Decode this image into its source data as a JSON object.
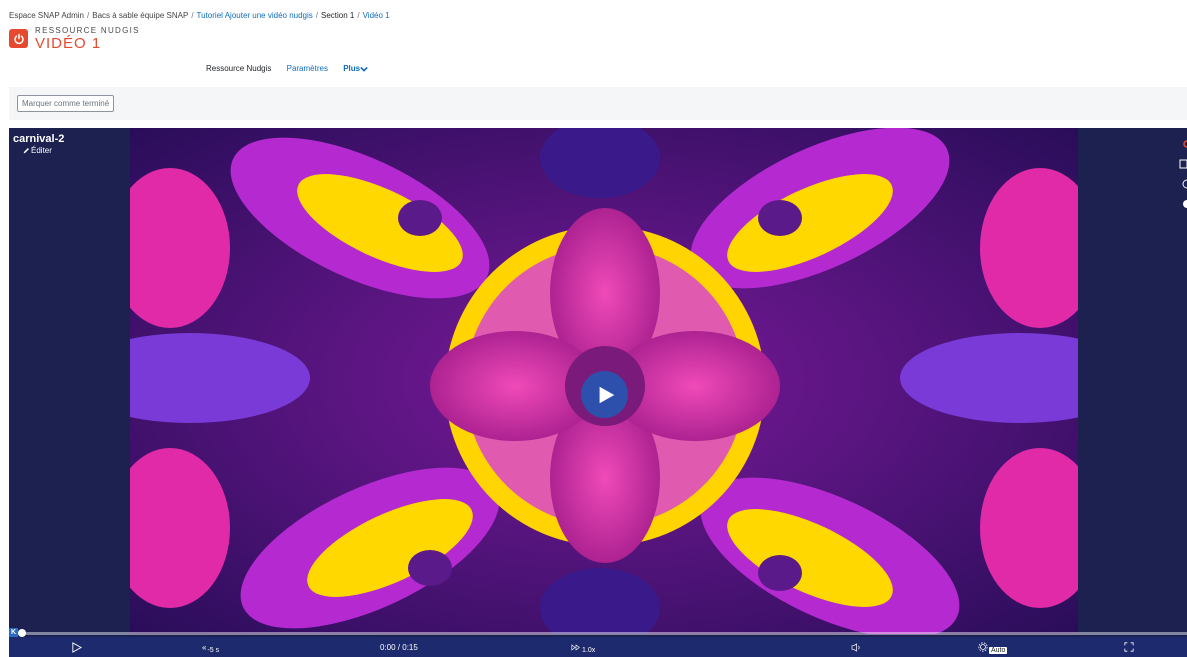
{
  "breadcrumb": [
    {
      "label": "Espace SNAP Admin",
      "kind": "plain"
    },
    {
      "label": "Bacs à sable équipe SNAP",
      "kind": "plain"
    },
    {
      "label": "Tutoriel Ajouter une vidéo nudgis",
      "kind": "link"
    },
    {
      "label": "Section 1",
      "kind": "current"
    },
    {
      "label": "Vidéo 1",
      "kind": "link"
    }
  ],
  "header": {
    "module_type": "RESSOURCE NUDGIS",
    "title": "VIDÉO 1",
    "icon": "nudgis-power-icon"
  },
  "nav": {
    "resource": "Ressource Nudgis",
    "settings": "Paramètres",
    "more": "Plus"
  },
  "completion": {
    "button_label": "Marquer comme terminé"
  },
  "player": {
    "video_title": "carnival-2",
    "edit_label": "Éditer",
    "progress_fraction": 0,
    "start_marker": "K",
    "controls": {
      "seek_back": "-5 s",
      "time": "0:00 / 0:15",
      "speed": "1.0x",
      "quality": "Auto"
    }
  },
  "colors": {
    "accent": "#e64a2e",
    "link": "#0f6cbf",
    "player_bg": "#1c2150",
    "controls_bg": "#1e2a6e"
  }
}
